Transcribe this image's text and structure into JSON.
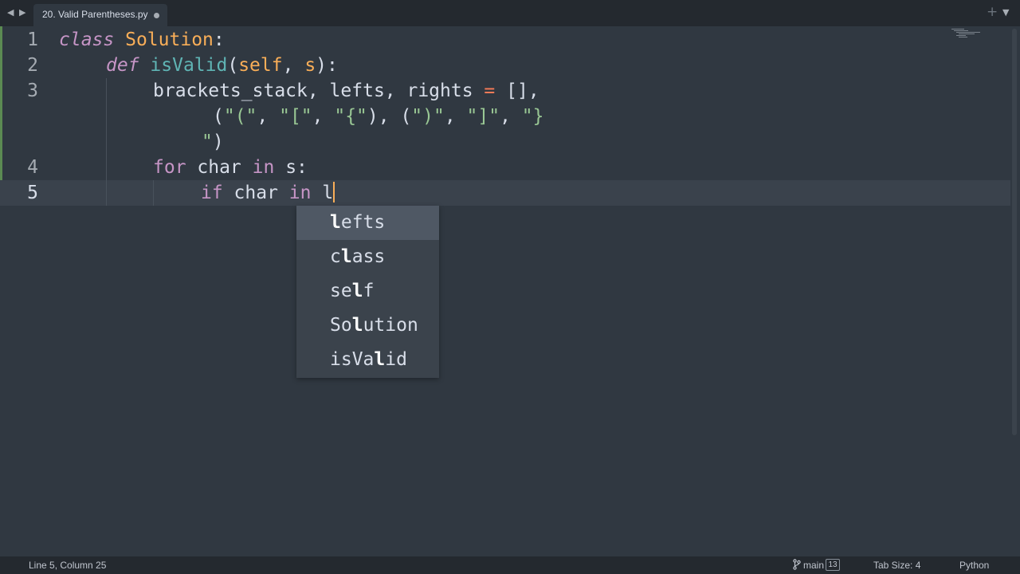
{
  "tabbar": {
    "back_icon": "◀",
    "forward_icon": "▶",
    "tab_title": "20. Valid Parentheses.py",
    "new_tab_icon": "+",
    "menu_icon": "▼"
  },
  "gutter": {
    "line_numbers": [
      "1",
      "2",
      "3",
      "4",
      "5"
    ],
    "active_line": "5"
  },
  "code": {
    "line1": {
      "kw": "class",
      "name": "Solution",
      "colon": ":"
    },
    "line2": {
      "kw": "def",
      "fn": "isValid",
      "open": "(",
      "self": "self",
      "comma": ",",
      "param": "s",
      "close": "):"
    },
    "line3a": {
      "vars": "brackets_stack, lefts, rights ",
      "eq": "=",
      "rest": " [],"
    },
    "line3b": {
      "p1": "(",
      "s1": "\"(\"",
      "c1": ", ",
      "s2": "\"[\"",
      "c2": ", ",
      "s3": "\"{\"",
      "p2": "), (",
      "s4": "\")\"",
      "c3": ", ",
      "s5": "\"]\"",
      "c4": ", ",
      "s6": "\"}"
    },
    "line3c": {
      "s": "\"",
      "p": ")"
    },
    "line4": {
      "kw_for": "for",
      "v": " char ",
      "kw_in": "in",
      "rest": " s:"
    },
    "line5": {
      "kw_if": "if",
      "v": " char ",
      "kw_in": "in",
      "typed": " l"
    }
  },
  "autocomplete": {
    "items": [
      {
        "match": "l",
        "rest": "efts"
      },
      {
        "pre": "c",
        "match": "l",
        "rest": "ass"
      },
      {
        "pre": "se",
        "match": "l",
        "rest": "f"
      },
      {
        "pre": "So",
        "match": "l",
        "rest": "ution"
      },
      {
        "pre": "isVa",
        "match": "l",
        "rest": "id"
      }
    ],
    "selected_index": 0
  },
  "status": {
    "position": "Line 5, Column 25",
    "branch": "main",
    "branch_count": "13",
    "tab_size": "Tab Size: 4",
    "syntax": "Python"
  },
  "colors": {
    "background": "#303841",
    "keyword": "#c695c6",
    "class_name": "#f9ae58",
    "function": "#5fb4b4",
    "operator": "#f97b58",
    "string": "#99c794",
    "text": "#d8dee9"
  },
  "icons": {
    "back": "back-arrow-icon",
    "forward": "forward-arrow-icon",
    "dirty": "unsaved-dot-icon",
    "new_tab": "plus-icon",
    "menu": "dropdown-icon",
    "branch": "git-branch-icon"
  }
}
